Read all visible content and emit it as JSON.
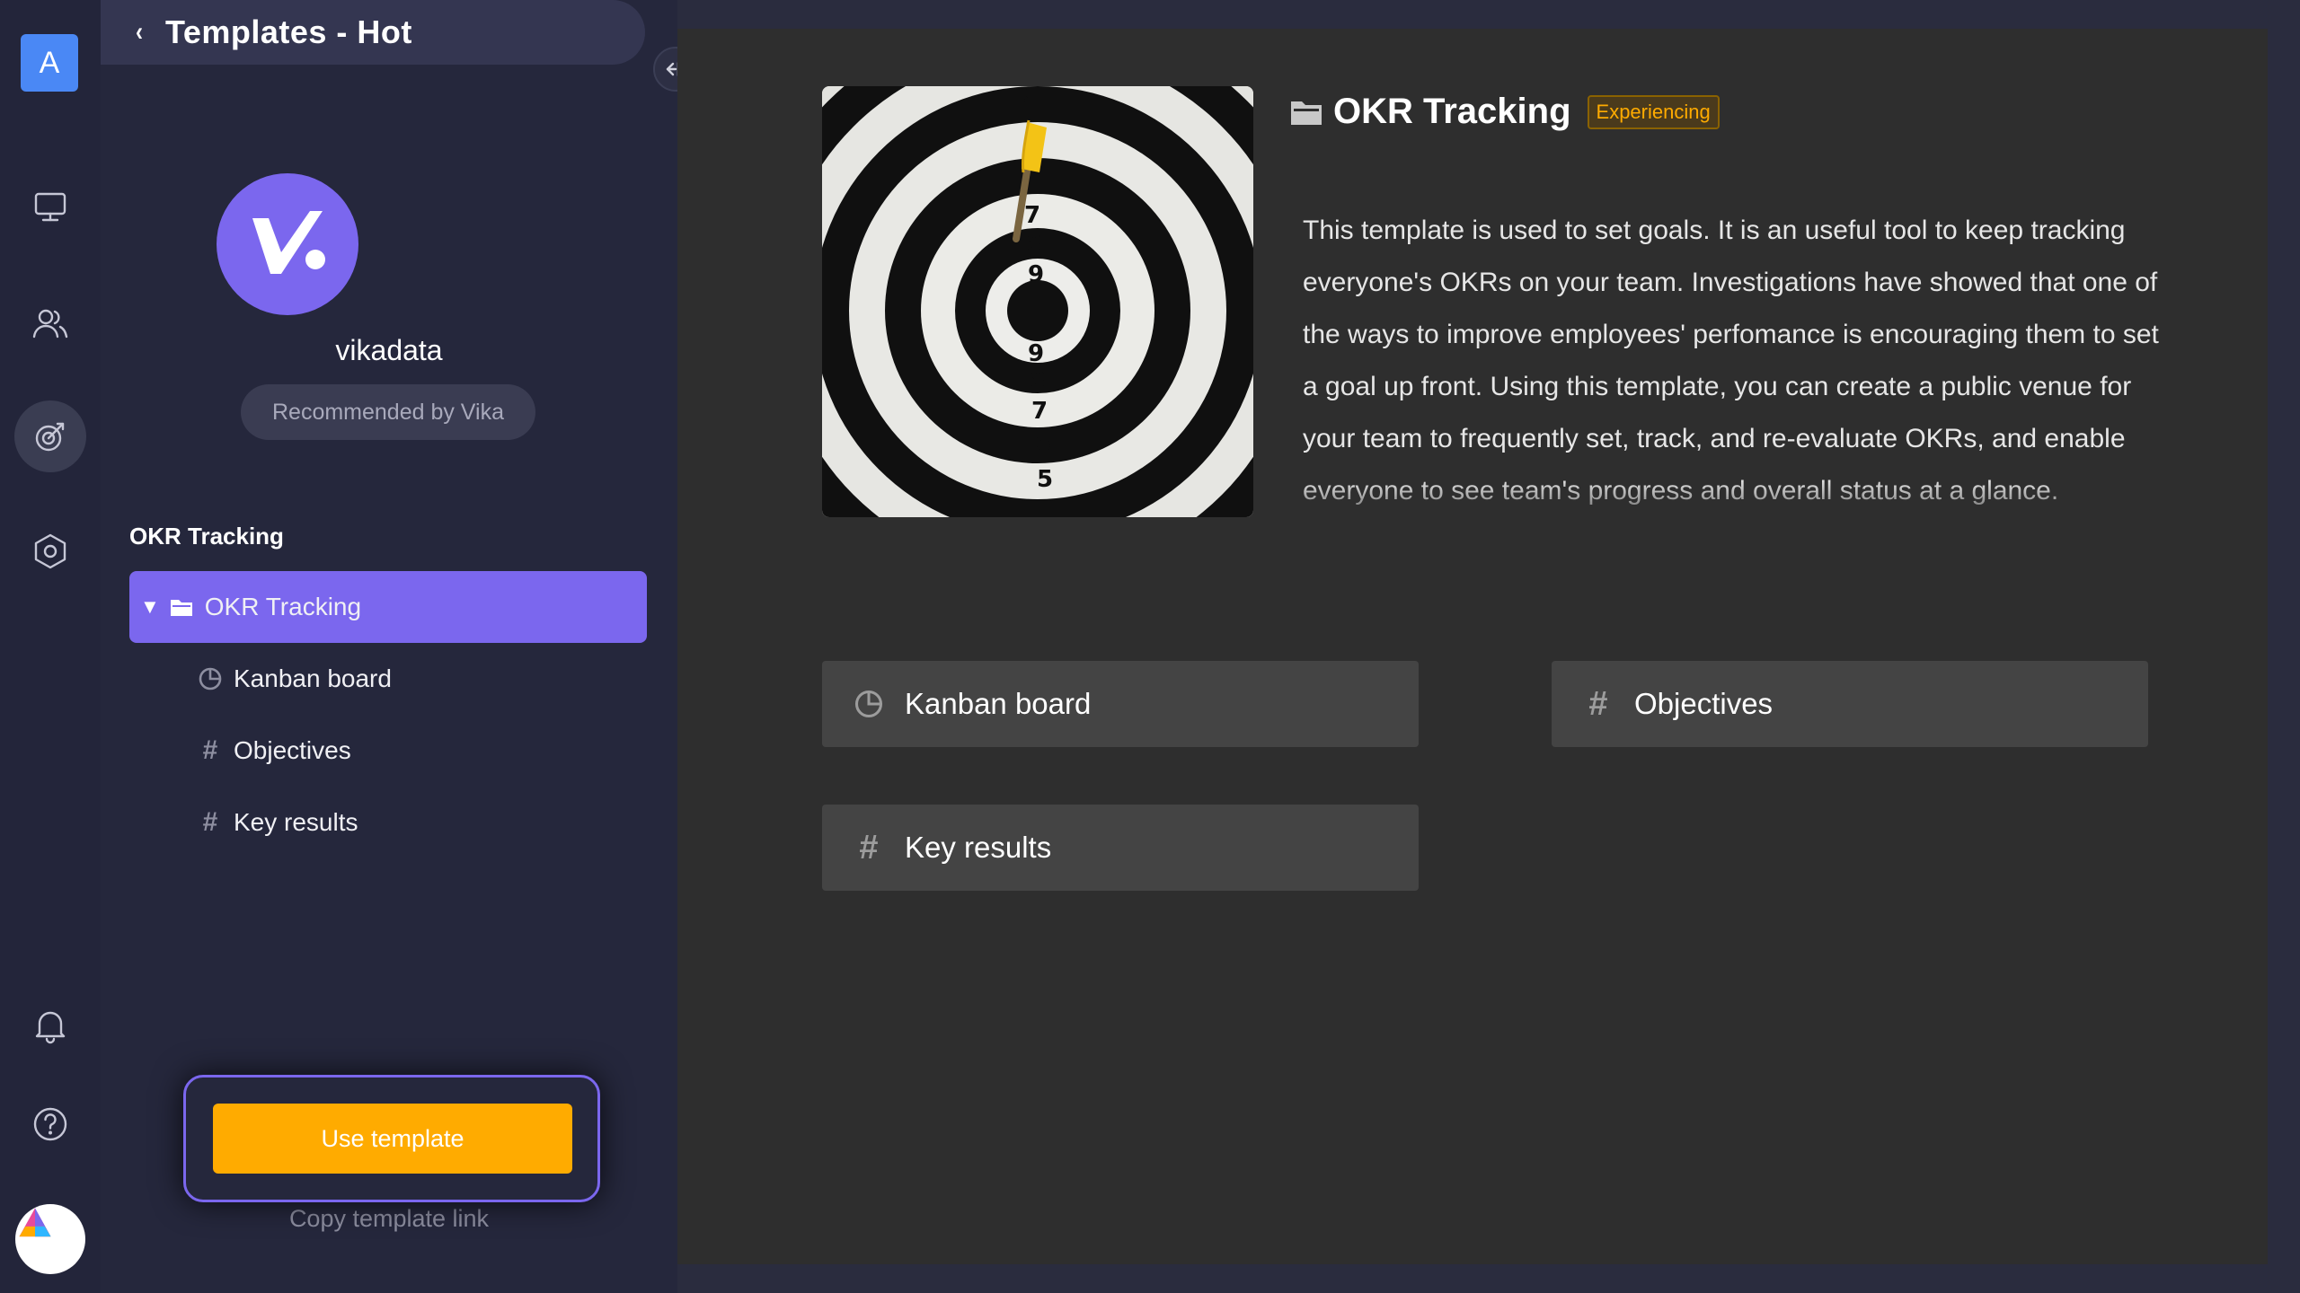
{
  "rail": {
    "avatar_letter": "A",
    "items": [
      "workbench-icon",
      "contacts-icon",
      "templates-icon",
      "settings-icon",
      "bell-icon",
      "help-icon"
    ]
  },
  "panel": {
    "back_icon": "‹",
    "title": "Templates - Hot",
    "creator_name": "vikadata",
    "recommend": "Recommended by Vika",
    "tree_title": "OKR Tracking",
    "tree": {
      "root": "OKR Tracking",
      "children": [
        "Kanban board",
        "Objectives",
        "Key results"
      ]
    },
    "use_template": "Use template",
    "copy_link": "Copy template link"
  },
  "main": {
    "template_name": "OKR Tracking",
    "tag": "Experiencing",
    "description": "This template is used to set goals. It is an useful tool to keep tracking everyone's OKRs on your team. Investigations have showed that one of the ways to improve employees' perfomance is encouraging them to set a goal up front. Using this template, you can create a public venue for your team to frequently set, track, and re-evaluate OKRs, and enable everyone to see team's progress and overall status at a glance.",
    "cards": [
      "Kanban board",
      "Objectives",
      "Key results"
    ]
  },
  "colors": {
    "accent": "#7b67ee",
    "button": "#ffab00",
    "rail_bg": "#23253a",
    "panel_bg": "#25273c",
    "main_bg": "#2e2e2e"
  }
}
